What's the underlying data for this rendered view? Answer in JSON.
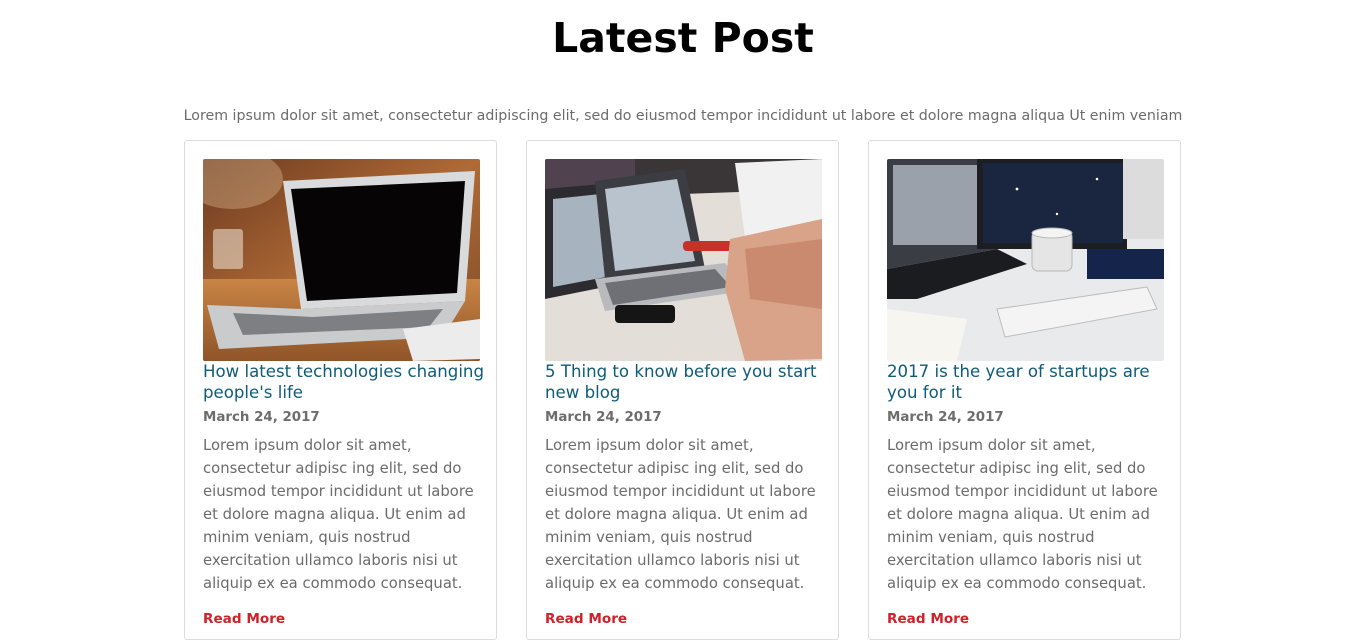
{
  "section": {
    "title": "Latest Post",
    "subtitle": "Lorem ipsum dolor sit amet, consectetur adipiscing elit, sed do eiusmod tempor incididunt ut labore et dolore magna aliqua Ut enim veniam"
  },
  "posts": [
    {
      "title": "How latest technologies changing people's life",
      "date": "March 24, 2017",
      "excerpt": "Lorem ipsum dolor sit amet, consectetur adipisc ing elit, sed do eiusmod tempor incididunt ut labore et dolore magna aliqua. Ut enim ad minim veniam, quis nostrud exercitation ullamco laboris nisi ut aliquip ex ea commodo consequat.",
      "read_more": "Read More",
      "image": "laptop-on-wooden-desk-photo"
    },
    {
      "title": "5 Thing to know before you start new blog",
      "date": "March 24, 2017",
      "excerpt": "Lorem ipsum dolor sit amet, consectetur adipisc ing elit, sed do eiusmod tempor incididunt ut labore et dolore magna aliqua. Ut enim ad minim veniam, quis nostrud exercitation ullamco laboris nisi ut aliquip ex ea commodo consequat.",
      "read_more": "Read More",
      "image": "laptops-on-meeting-table-photo"
    },
    {
      "title": "2017 is the year of startups are you for it",
      "date": "March 24, 2017",
      "excerpt": "Lorem ipsum dolor sit amet, consectetur adipisc ing elit, sed do eiusmod tempor incididunt ut labore et dolore magna aliqua. Ut enim ad minim veniam, quis nostrud exercitation ullamco laboris nisi ut aliquip ex ea commodo consequat.",
      "read_more": "Read More",
      "image": "desk-monitors-mug-keyboard-photo"
    }
  ],
  "colors": {
    "title": "#000000",
    "post_title": "#0f5b78",
    "read_more": "#d0202a",
    "body_text": "#6b6b6b",
    "card_border": "#dcdcdc"
  }
}
